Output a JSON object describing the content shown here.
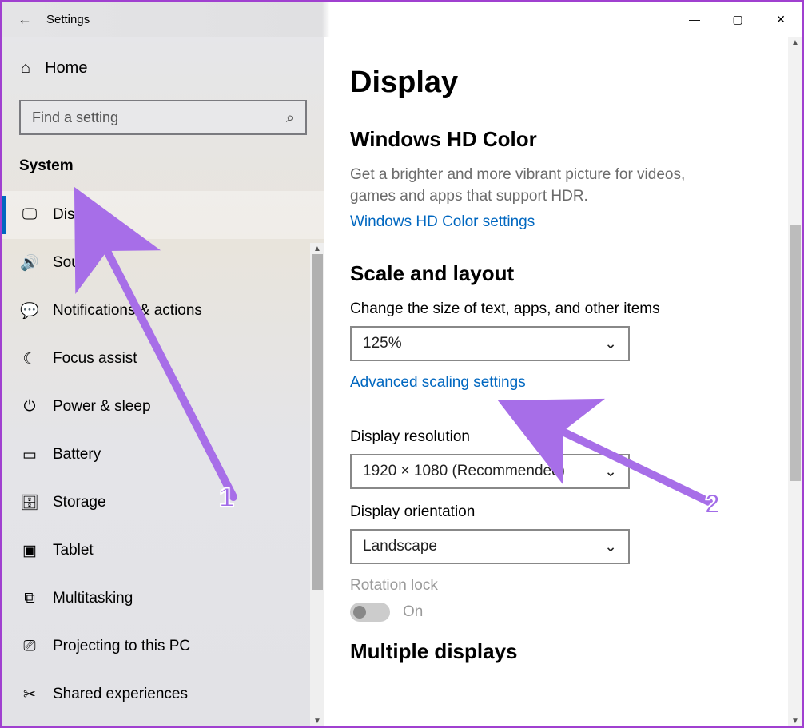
{
  "window": {
    "title": "Settings",
    "back_icon": "←",
    "minimize": "—",
    "maximize": "▢",
    "close": "✕"
  },
  "sidebar": {
    "home_icon": "⌂",
    "home_label": "Home",
    "search_placeholder": "Find a setting",
    "search_icon": "⌕",
    "category": "System",
    "items": [
      {
        "icon": "🖵",
        "label": "Display",
        "selected": true,
        "id": "display"
      },
      {
        "icon": "🔊",
        "label": "Sound",
        "id": "sound"
      },
      {
        "icon": "💬",
        "label": "Notifications & actions",
        "id": "notifications"
      },
      {
        "icon": "☾",
        "label": "Focus assist",
        "id": "focus-assist"
      },
      {
        "icon": "⏻",
        "label": "Power & sleep",
        "id": "power-sleep"
      },
      {
        "icon": "▭",
        "label": "Battery",
        "id": "battery"
      },
      {
        "icon": "🗄",
        "label": "Storage",
        "id": "storage"
      },
      {
        "icon": "▣",
        "label": "Tablet",
        "id": "tablet"
      },
      {
        "icon": "⧉",
        "label": "Multitasking",
        "id": "multitasking"
      },
      {
        "icon": "⎚",
        "label": "Projecting to this PC",
        "id": "projecting"
      },
      {
        "icon": "✂",
        "label": "Shared experiences",
        "id": "shared-experiences"
      }
    ]
  },
  "main": {
    "page_title": "Display",
    "hdcolor": {
      "heading": "Windows HD Color",
      "desc": "Get a brighter and more vibrant picture for videos, games and apps that support HDR.",
      "link": "Windows HD Color settings"
    },
    "scale": {
      "heading": "Scale and layout",
      "size_label": "Change the size of text, apps, and other items",
      "size_value": "125%",
      "advanced_link": "Advanced scaling settings",
      "resolution_label": "Display resolution",
      "resolution_value": "1920 × 1080 (Recommended)",
      "orientation_label": "Display orientation",
      "orientation_value": "Landscape",
      "rotation_label": "Rotation lock",
      "rotation_state": "On"
    },
    "multiple_heading": "Multiple displays"
  },
  "annotations": {
    "one": "1",
    "two": "2"
  },
  "chevron": "⌄"
}
